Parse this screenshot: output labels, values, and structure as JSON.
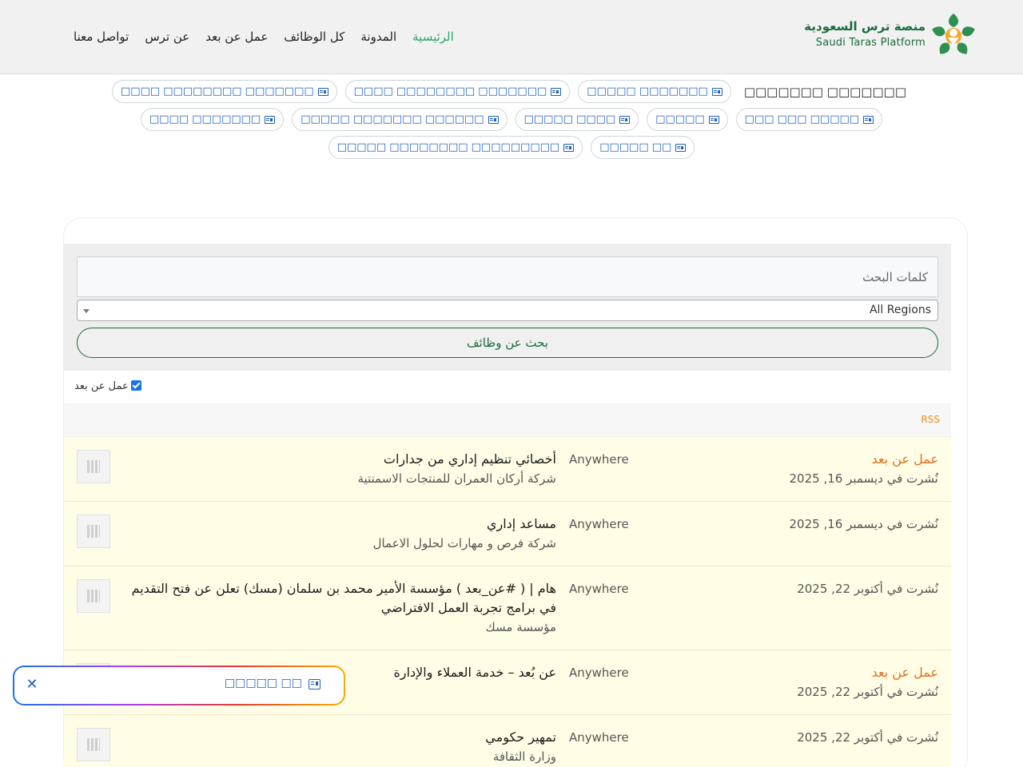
{
  "header": {
    "logo_ar": "منصة ترس السعودية",
    "logo_en": "Saudi Taras Platform",
    "nav": [
      {
        "label": "الرئيسية",
        "active": true
      },
      {
        "label": "المدونة"
      },
      {
        "label": "كل الوظائف"
      },
      {
        "label": "عمل عن بعد"
      },
      {
        "label": "عن ترس"
      },
      {
        "label": "تواصل معنا"
      }
    ]
  },
  "categories": {
    "label": "□□□□□□□ □□□□□□□",
    "rows": [
      [
        "□□□□□□□ □□□□□",
        "□□□□□□□ □□□□□□□□ □□□□",
        "□□□□□□□ □□□□□□□□ □□□□"
      ],
      [
        "□□□□□ □□□ □□□",
        "□□□□□",
        "□□□□ □□□□□",
        "□□□□□□ □□□□□□□ □□□□□",
        "□□□□□□□ □□□□"
      ],
      [
        "□□ □□□□□",
        "□□□□□□□□□ □□□□□□□□ □□□□□"
      ]
    ]
  },
  "search": {
    "keywords_placeholder": "كلمات البحث",
    "region_value": "All Regions",
    "button_label": "بحث عن وظائف",
    "remote_label": "عمل عن بعد",
    "remote_checked": true,
    "rss_label": "RSS"
  },
  "jobs": [
    {
      "title": "أخصائي تنظيم إداري من جدارات",
      "company": "شركة أركان العمران للمنتجات الاسمنتية",
      "location": "Anywhere",
      "type": "عمل عن بعد",
      "date": "نُشرت في ديسمبر 16, 2025"
    },
    {
      "title": "مساعد إداري",
      "company": "شركة فرص و مهارات لحلول الاعمال",
      "location": "Anywhere",
      "type": "",
      "date": "نُشرت في ديسمبر 16, 2025"
    },
    {
      "title": "هام | ( #عن_بعد ) مؤسسة الأمير محمد بن سلمان (مسك) تعلن عن فتح التقديم في برامج تجربة العمل الافتراضي",
      "company": "مؤسسة مسك",
      "location": "Anywhere",
      "type": "",
      "date": "نُشرت في أكتوبر 22, 2025"
    },
    {
      "title": "عن بُعد – خدمة العملاء والإدارة",
      "company": "",
      "location": "Anywhere",
      "type": "عمل عن بعد",
      "date": "نُشرت في أكتوبر 22, 2025"
    },
    {
      "title": "تمهير حكومي",
      "company": "وزارة الثقافة",
      "location": "Anywhere",
      "type": "",
      "date": "نُشرت في أكتوبر 22, 2025"
    }
  ],
  "banner": {
    "text": "□□ □□□□□"
  },
  "colors": {
    "brand_green": "#1a6b3a",
    "nav_active": "#2aa36b",
    "remote_orange": "#e07020",
    "link_blue": "#1f5fbf",
    "job_bg": "#fffde6"
  }
}
